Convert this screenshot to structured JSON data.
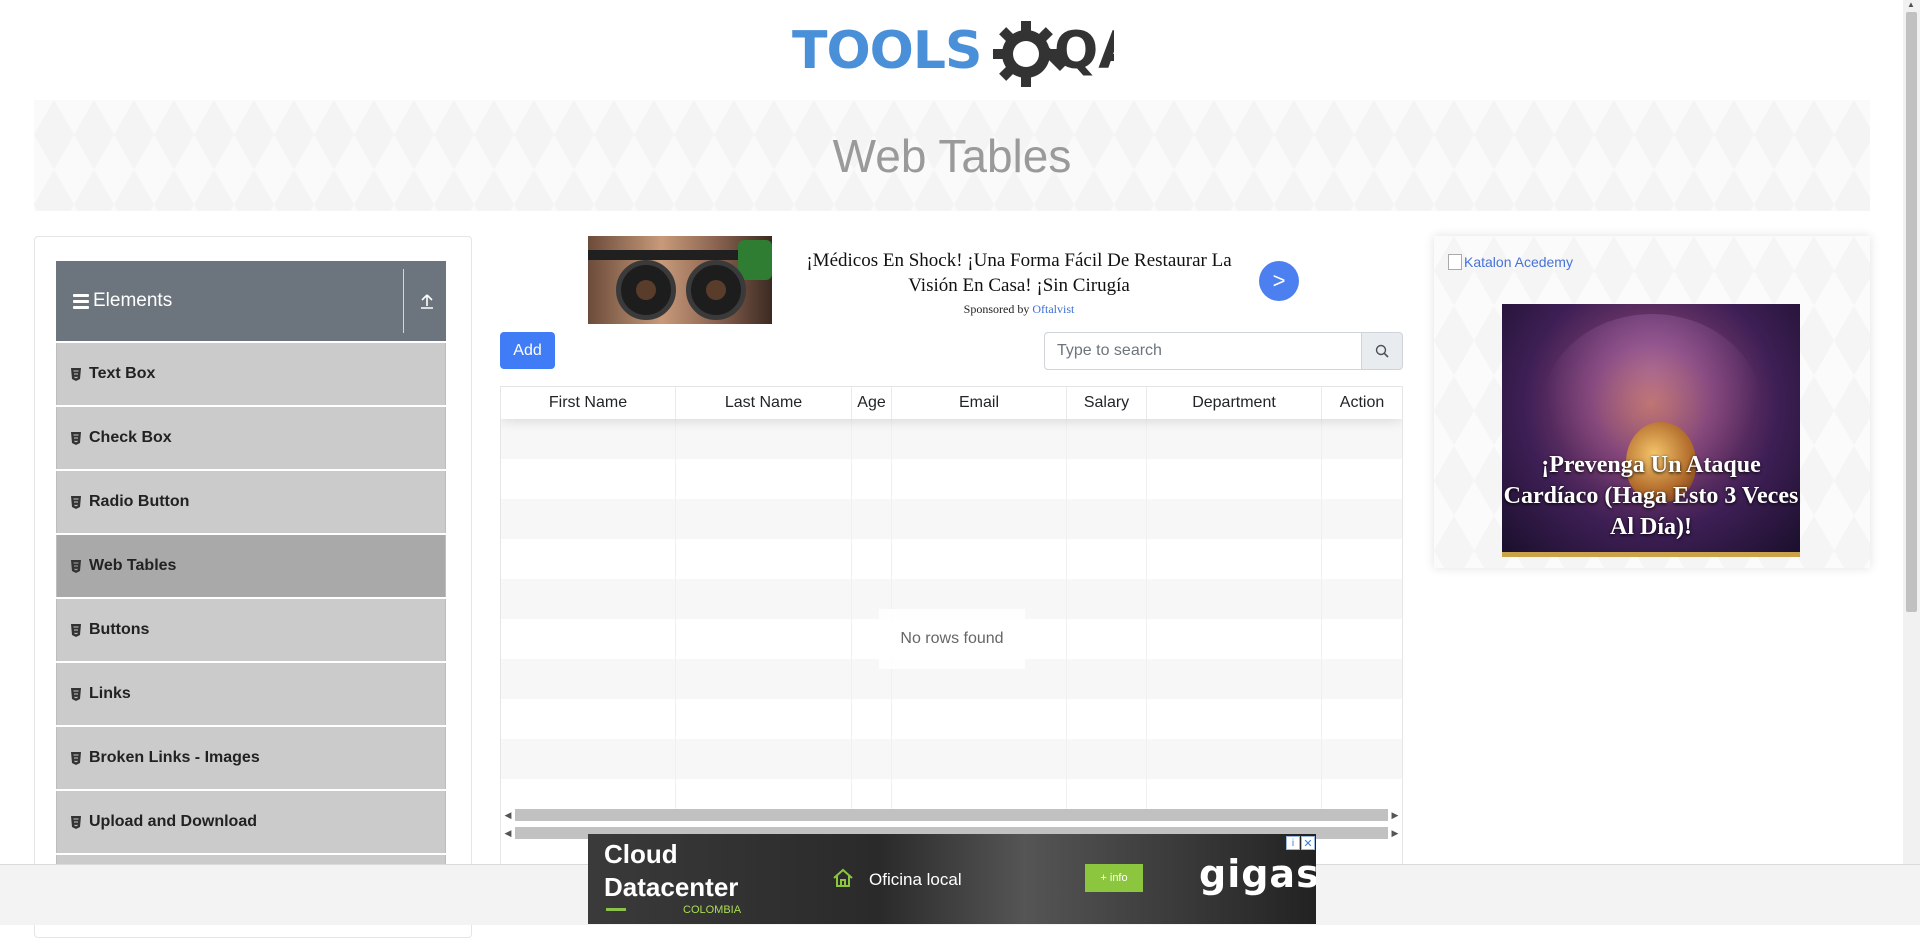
{
  "logo": {
    "text_left": "TOOLS",
    "text_right": "QA",
    "accent": "#4a90d9",
    "dark": "#333333"
  },
  "banner": {
    "title": "Web Tables"
  },
  "sidebar": {
    "group_title": "Elements",
    "items": [
      {
        "label": "Text Box",
        "active": false
      },
      {
        "label": "Check Box",
        "active": false
      },
      {
        "label": "Radio Button",
        "active": false
      },
      {
        "label": "Web Tables",
        "active": true
      },
      {
        "label": "Buttons",
        "active": false
      },
      {
        "label": "Links",
        "active": false
      },
      {
        "label": "Broken Links - Images",
        "active": false
      },
      {
        "label": "Upload and Download",
        "active": false
      }
    ]
  },
  "ad_top": {
    "headline": "¡Médicos En Shock! ¡Una Forma Fácil De Restaurar La Visión En Casa! ¡Sin Cirugía",
    "sponsor_prefix": "Sponsored by",
    "sponsor_name": "Oftalvist",
    "go_label": ">"
  },
  "controls": {
    "add_label": "Add",
    "search_placeholder": "Type to search",
    "search_value": ""
  },
  "table": {
    "columns": [
      "First Name",
      "Last Name",
      "Age",
      "Email",
      "Salary",
      "Department",
      "Action"
    ],
    "rows": [],
    "empty_text": "No rows found"
  },
  "ad_right": {
    "alt_text": "Katalon Acedemy",
    "caption": "¡Prevenga Un Ataque Cardíaco (Haga Esto 3 Veces Al Día)!"
  },
  "ad_bottom": {
    "title": "Cloud Datacenter",
    "country": "COLOMBIA",
    "office": "Oficina local",
    "info_label": "+ info",
    "brand": "gigas",
    "adchoice": "i",
    "close": "✕"
  },
  "colors": {
    "primary": "#3f7cf6",
    "sidebar_header": "#6c757d",
    "menu_item": "#cbcbcb",
    "menu_item_active": "#a9a9a9"
  }
}
